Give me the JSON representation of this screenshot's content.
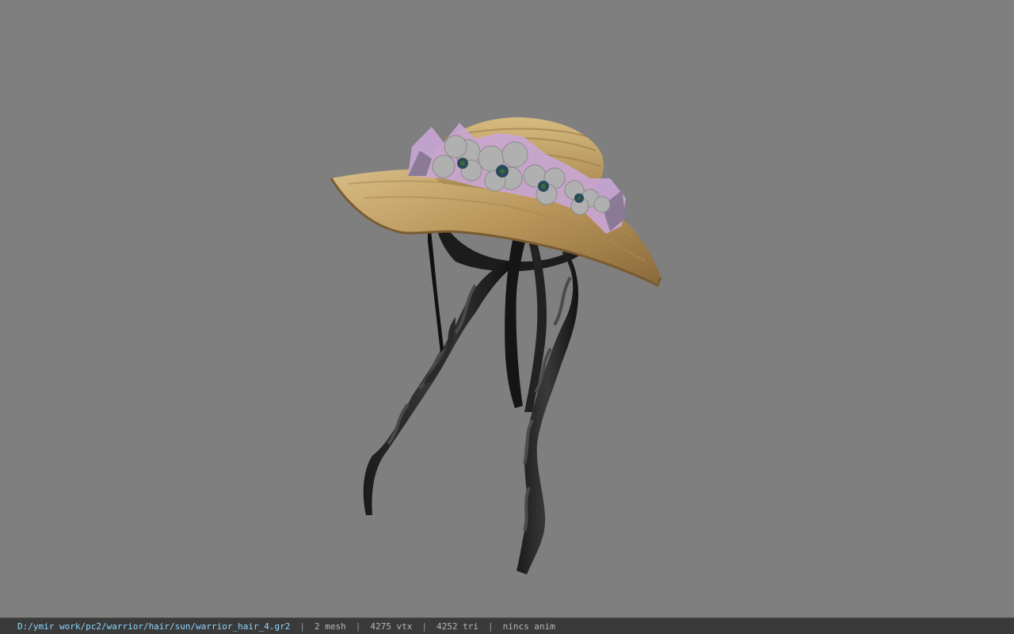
{
  "viewer": {
    "background_color": "#7f7f7f",
    "model": "hat-and-hair-model"
  },
  "status_bar": {
    "file_path": "D:/ymir work/pc2/warrior/hair/sun/warrior_hair_4.gr2",
    "separator": "|",
    "mesh_count": "2 mesh",
    "vertex_count": "4275 vtx",
    "triangle_count": "4252 tri",
    "anim_status": "nincs anim"
  },
  "colors": {
    "path_text": "#8fd8ff",
    "status_text": "#b8b8b8",
    "status_bg": "#3a3a3a"
  }
}
